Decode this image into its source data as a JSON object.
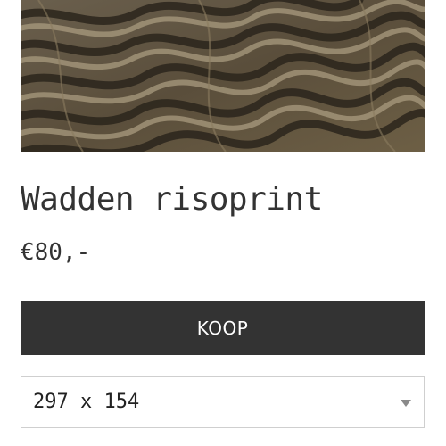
{
  "product": {
    "title": "Wadden risoprint",
    "price": "€80,-",
    "buy_label": "KOOP",
    "size_select": {
      "selected": "297 x 154",
      "options": [
        "297 x 154"
      ]
    },
    "image": {
      "subject": "mudflat sand ripples",
      "colors": {
        "base": "#5d5241",
        "light": "#a79a80",
        "dark": "#2a241c"
      }
    }
  },
  "colors": {
    "button_bg": "#333333",
    "button_text": "#ffffff",
    "text": "#333333",
    "select_border": "#cfcfcf"
  }
}
